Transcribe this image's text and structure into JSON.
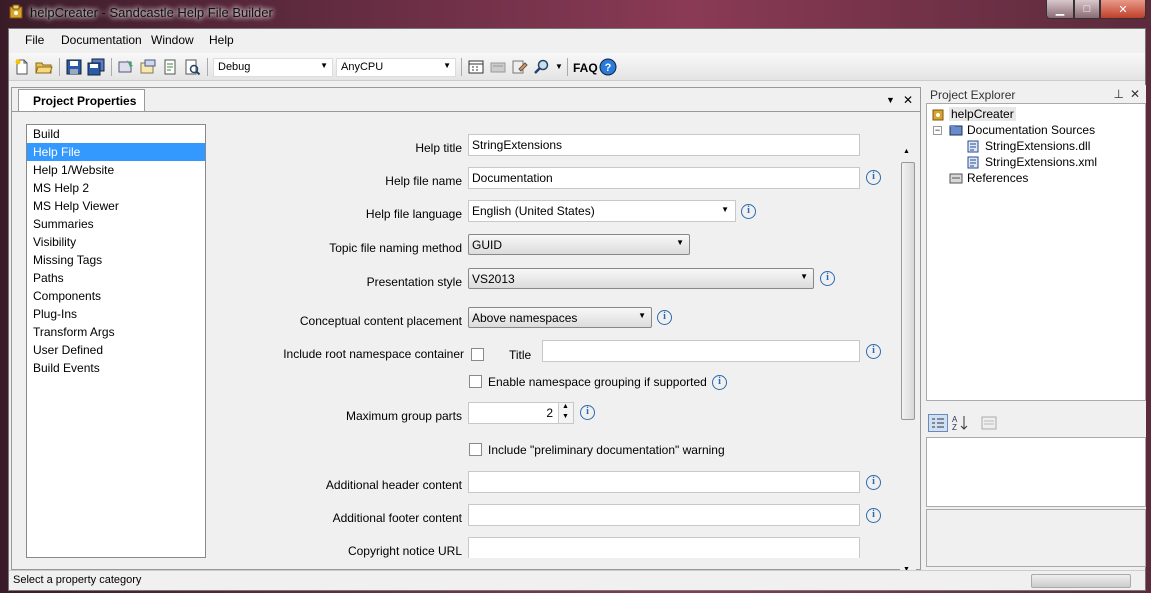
{
  "window": {
    "title": "helpCreater - Sandcastle Help File Builder",
    "min_icon": "minimize-icon",
    "max_icon": "maximize-icon",
    "close_icon": "close-icon"
  },
  "menu": {
    "items": [
      "File",
      "Documentation",
      "Window",
      "Help"
    ]
  },
  "toolbar": {
    "config_value": "Debug",
    "platform_value": "AnyCPU",
    "faq_label": "FAQ"
  },
  "document": {
    "tab_label": "Project Properties"
  },
  "categories": {
    "items": [
      "Build",
      "Help File",
      "Help 1/Website",
      "MS Help 2",
      "MS Help Viewer",
      "Summaries",
      "Visibility",
      "Missing Tags",
      "Paths",
      "Components",
      "Plug-Ins",
      "Transform Args",
      "User Defined",
      "Build Events"
    ],
    "selected_index": 1
  },
  "props": {
    "help_title_label": "Help title",
    "help_title_value": "StringExtensions",
    "help_file_name_label": "Help file name",
    "help_file_name_value": "Documentation",
    "language_label": "Help file language",
    "language_value": "English (United States)",
    "naming_label": "Topic file naming method",
    "naming_value": "GUID",
    "presentation_label": "Presentation style",
    "presentation_value": "VS2013",
    "placement_label": "Conceptual content placement",
    "placement_value": "Above namespaces",
    "root_ns_label": "Include root namespace container",
    "root_title_label": "Title",
    "root_title_value": "",
    "ns_grouping_label": "Enable namespace grouping if supported",
    "max_group_label": "Maximum group parts",
    "max_group_value": "2",
    "preliminary_label": "Include \"preliminary documentation\" warning",
    "header_label": "Additional header content",
    "header_value": "",
    "footer_label": "Additional footer content",
    "footer_value": "",
    "copyright_label": "Copyright notice URL",
    "copyright_value": ""
  },
  "explorer": {
    "title": "Project Explorer",
    "project": "helpCreater",
    "doc_sources": "Documentation Sources",
    "dll": "StringExtensions.dll",
    "xml": "StringExtensions.xml",
    "references": "References"
  },
  "status": {
    "text": "Select a property category"
  },
  "colors": {
    "selection": "#3399ff",
    "info": "#2a6ab0"
  }
}
